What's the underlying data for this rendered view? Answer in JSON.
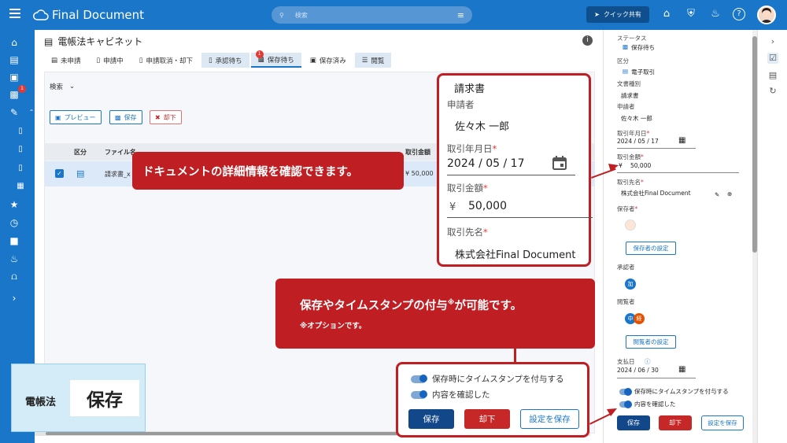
{
  "app": {
    "name": "Final Document"
  },
  "header": {
    "search_placeholder": "検索",
    "quick_share_label": "クイック共有"
  },
  "sidenav": {
    "badge_count": "1"
  },
  "cabinet": {
    "title": "電帳法キャビネット",
    "tabs": [
      {
        "label": "未申請"
      },
      {
        "label": "申請中"
      },
      {
        "label": "申請取消・却下"
      },
      {
        "label": "承認待ち"
      },
      {
        "label": "保存待ち",
        "badge": "1"
      },
      {
        "label": "保存済み"
      },
      {
        "label": "閲覧"
      }
    ],
    "search_label": "検索",
    "toolbar": {
      "preview": "プレビュー",
      "save": "保存",
      "reject": "却下"
    },
    "columns": {
      "category": "区分",
      "filename": "ファイル名",
      "amount": "取引金額"
    },
    "row": {
      "filename": "請求書_x",
      "amount": "¥ 50,000"
    }
  },
  "detail_panel": {
    "status_label": "ステータス",
    "status_value": "保存待ち",
    "category_label": "区分",
    "category_value": "電子取引",
    "doctype_label": "文書種別",
    "doctype_value": "請求書",
    "applicant_label": "申請者",
    "applicant_value": "佐々木 一郎",
    "date_label": "取引年月日",
    "date_value": "2024 / 05 / 17",
    "amount_label": "取引金額",
    "amount_value": "50,000",
    "currency": "¥",
    "partner_label": "取引先名",
    "partner_value": "株式会社Final Document",
    "keeper_label": "保存者",
    "keeper_button": "保存者の設定",
    "approver_label": "承認者",
    "approver_avatar": "加",
    "viewer_label": "閲覧者",
    "viewer_avatars": [
      "中",
      "経"
    ],
    "viewer_button": "閲覧者の設定",
    "payment_label": "支払日",
    "payment_value": "2024 / 06 / 30",
    "toggle_timestamp": "保存時にタイムスタンプを付与する",
    "toggle_confirm": "内容を確認した",
    "btn_save": "保存",
    "btn_reject": "却下",
    "btn_settings": "設定を保存"
  },
  "zoom": {
    "doctype": "請求書",
    "applicant_label": "申請者",
    "applicant_value": "佐々木 一郎",
    "date_label": "取引年月日",
    "date_value": "2024 / 05 / 17",
    "amount_label": "取引金額",
    "currency": "¥",
    "amount_value": "50,000",
    "partner_label": "取引先名",
    "partner_value": "株式会社Final Document"
  },
  "callouts": {
    "details": "ドキュメントの詳細情報を確認できます。",
    "timestamp_main": "保存やタイムスタンプの付与",
    "timestamp_mark": "※",
    "timestamp_tail": "が可能です。",
    "option_note": "※オプションです。"
  },
  "corner_badge": {
    "law": "電帳法",
    "action": "保存"
  },
  "colors": {
    "primary": "#1976c8",
    "callout": "#bf1e23",
    "save": "#12478a",
    "reject": "#c62828"
  }
}
